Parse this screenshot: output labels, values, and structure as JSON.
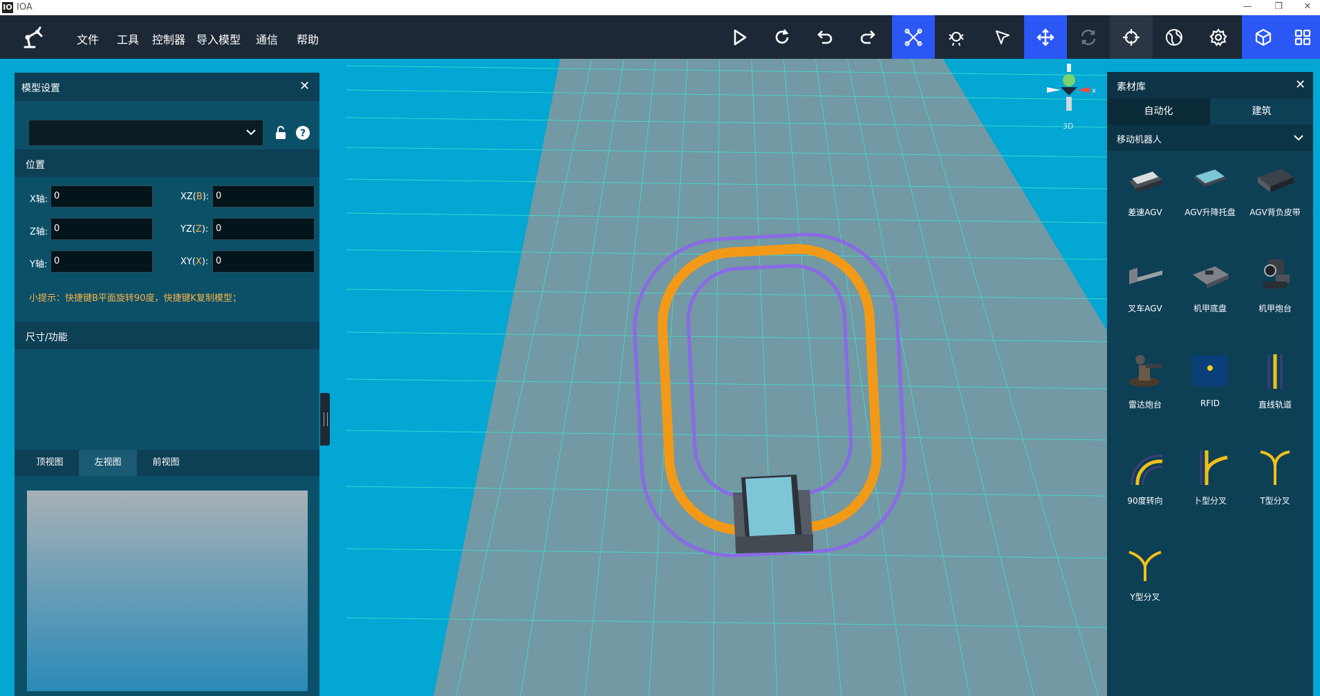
{
  "window": {
    "title": "IOA",
    "logo_glyph": "IO",
    "controls": [
      "—",
      "❐",
      "✕"
    ]
  },
  "menu": [
    "文件",
    "工具",
    "控制器",
    "导入模型",
    "通信",
    "帮助"
  ],
  "toolbar": [
    {
      "icon": "play-icon",
      "active": false
    },
    {
      "icon": "refresh-icon",
      "active": false
    },
    {
      "icon": "undo-icon",
      "active": false
    },
    {
      "icon": "redo-icon",
      "active": false
    },
    {
      "icon": "drone-icon",
      "active": true
    },
    {
      "icon": "robot-icon",
      "active": false
    },
    {
      "icon": "pointer-icon",
      "active": false
    },
    {
      "icon": "move-icon",
      "active": true
    },
    {
      "icon": "rotate-icon",
      "active": false
    },
    {
      "icon": "target-icon",
      "active": false
    },
    {
      "icon": "globe-icon",
      "active": false
    },
    {
      "icon": "gear-icon",
      "active": false
    },
    {
      "icon": "cube-icon",
      "active": true
    },
    {
      "icon": "grid-icon",
      "active": true
    }
  ],
  "left_panel": {
    "title": "模型设置",
    "select_value": "",
    "position_section": "位置",
    "fields": [
      {
        "label": "X轴",
        "colon": ":",
        "value": "0"
      },
      {
        "label": "XZ(",
        "hl": "B",
        "tail": "):",
        "value": "0"
      },
      {
        "label": "Z轴",
        "colon": ":",
        "value": "0"
      },
      {
        "label": "YZ(",
        "hl": "Z",
        "tail": "):",
        "value": "0"
      },
      {
        "label": "Y轴",
        "colon": ":",
        "value": "0"
      },
      {
        "label": "XY(",
        "hl": "X",
        "tail": "):",
        "value": "0"
      }
    ],
    "hint": "小提示：快捷键B平面旋转90度，快捷键K复制模型；",
    "size_section": "尺寸/功能",
    "views": [
      "顶视图",
      "左视图",
      "前视图"
    ],
    "active_view": 1
  },
  "gizmo": {
    "axis_x": "x",
    "label": "3D"
  },
  "right_panel": {
    "title": "素材库",
    "tabs": [
      "自动化",
      "建筑"
    ],
    "active_tab": 0,
    "category": "移动机器人",
    "assets": [
      "差速AGV",
      "AGV升降托盘",
      "AGV背负皮带",
      "叉车AGV",
      "机甲底盘",
      "机甲炮台",
      "雷达炮台",
      "RFID",
      "直线轨道",
      "90度转向",
      "卜型分叉",
      "T型分叉",
      "Y型分叉"
    ]
  }
}
